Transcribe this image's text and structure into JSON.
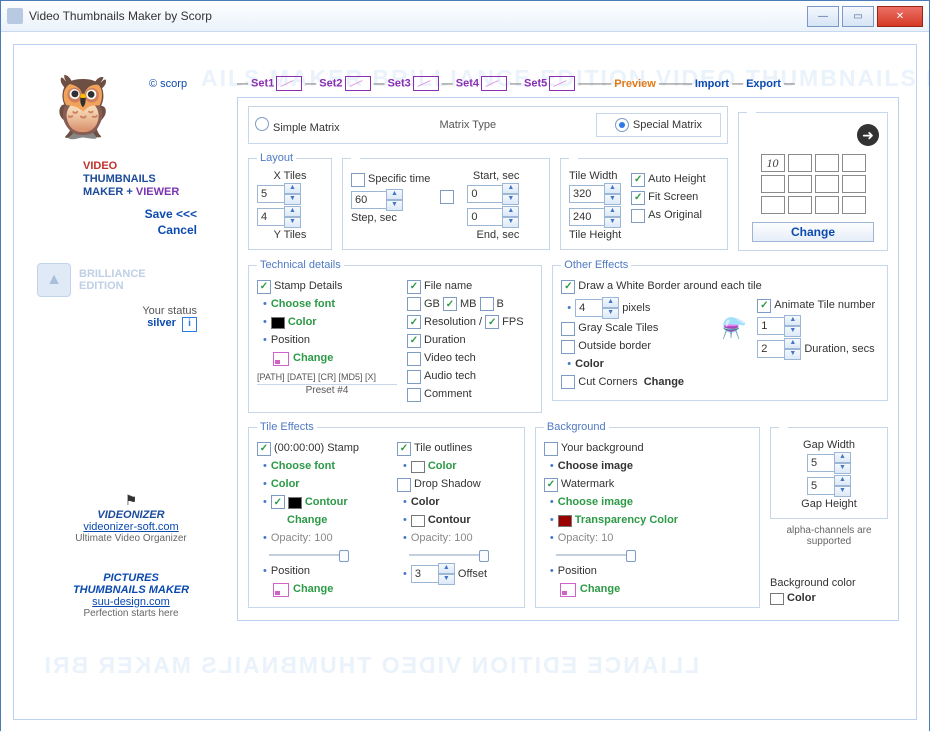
{
  "window": {
    "title": "Video Thumbnails Maker by Scorp"
  },
  "sidebar": {
    "copyright": "© scorp",
    "brand": {
      "r": "VIDEO",
      "b1": "THUMBNAILS",
      "b2": "MAKER",
      "plus": "+",
      "v": "VIEWER"
    },
    "save": "Save <<<",
    "cancel": "Cancel",
    "edition": "BRILLIANCE\nEDITION",
    "status_lab": "Your status",
    "status_val": "silver",
    "promo1_t": "VIDEONIZER",
    "promo1_u": "videonizer-soft.com",
    "promo1_s": "Ultimate Video Organizer",
    "promo2_t": "PICTURES\nTHUMBNAILS MAKER",
    "promo2_u": "suu-design.com",
    "promo2_s": "Perfection starts here"
  },
  "tabs": {
    "set1": "Set1",
    "set2": "Set2",
    "set3": "Set3",
    "set4": "Set4",
    "set5": "Set5",
    "preview": "Preview",
    "import": "Import",
    "export": "Export"
  },
  "matrix": {
    "simple": "Simple Matrix",
    "label": "Matrix Type",
    "special": "Special Matrix",
    "change": "Change",
    "count": "10"
  },
  "layout": {
    "legend": "Layout",
    "xtiles": "X Tiles",
    "ytiles": "Y Tiles",
    "xval": "5",
    "yval": "4",
    "speclab": "Specific time",
    "stepval": "60",
    "steplab": "Step, sec",
    "startlab": "Start, sec",
    "endlab": "End, sec",
    "startval": "0",
    "endval": "0",
    "twlab": "Tile Width",
    "thlab": "Tile Height",
    "twval": "320",
    "thval": "240",
    "autoh": "Auto Height",
    "fit": "Fit Screen",
    "asorig": "As Original"
  },
  "tech": {
    "legend": "Technical  details",
    "stamp": "Stamp Details",
    "choosefont": "Choose font",
    "color": "Color",
    "position": "Position",
    "change": "Change",
    "preset_path": "[PATH] [DATE] [CR] [MD5] [X]",
    "preset": "Preset #4",
    "fname": "File name",
    "gb": "GB",
    "mb": "MB",
    "b": "B",
    "res": "Resolution /",
    "fps": "FPS",
    "dur": "Duration",
    "vtech": "Video tech",
    "atech": "Audio tech",
    "cmt": "Comment"
  },
  "tile": {
    "legend": "Tile Effects",
    "stamp": "(00:00:00) Stamp",
    "choosefont": "Choose font",
    "color": "Color",
    "contour": "Contour",
    "change": "Change",
    "opacity": "Opacity: 100",
    "position": "Position",
    "outlines": "Tile outlines",
    "drop": "Drop Shadow",
    "offsetval": "3",
    "offset": "Offset"
  },
  "other": {
    "legend": "Other Effects",
    "draw": "Draw a White Border around each tile",
    "pxval": "4",
    "px": "pixels",
    "gray": "Gray Scale Tiles",
    "outborder": "Outside border",
    "color": "Color",
    "cut": "Cut Corners",
    "change": "Change",
    "anim": "Animate Tile number",
    "animn": "1",
    "animd": "2",
    "durlab": "Duration, secs",
    "gapw": "Gap Width",
    "gaph": "Gap Height",
    "gapwv": "5",
    "gaphv": "5",
    "alpha": "alpha-channels are supported"
  },
  "bg": {
    "legend": "Background",
    "yourbg": "Your background",
    "chooseimg": "Choose image",
    "wm": "Watermark",
    "transp": "Transparency Color",
    "opacity": "Opacity: 10",
    "position": "Position",
    "change": "Change",
    "bgcol_lab": "Background color",
    "color": "Color"
  }
}
